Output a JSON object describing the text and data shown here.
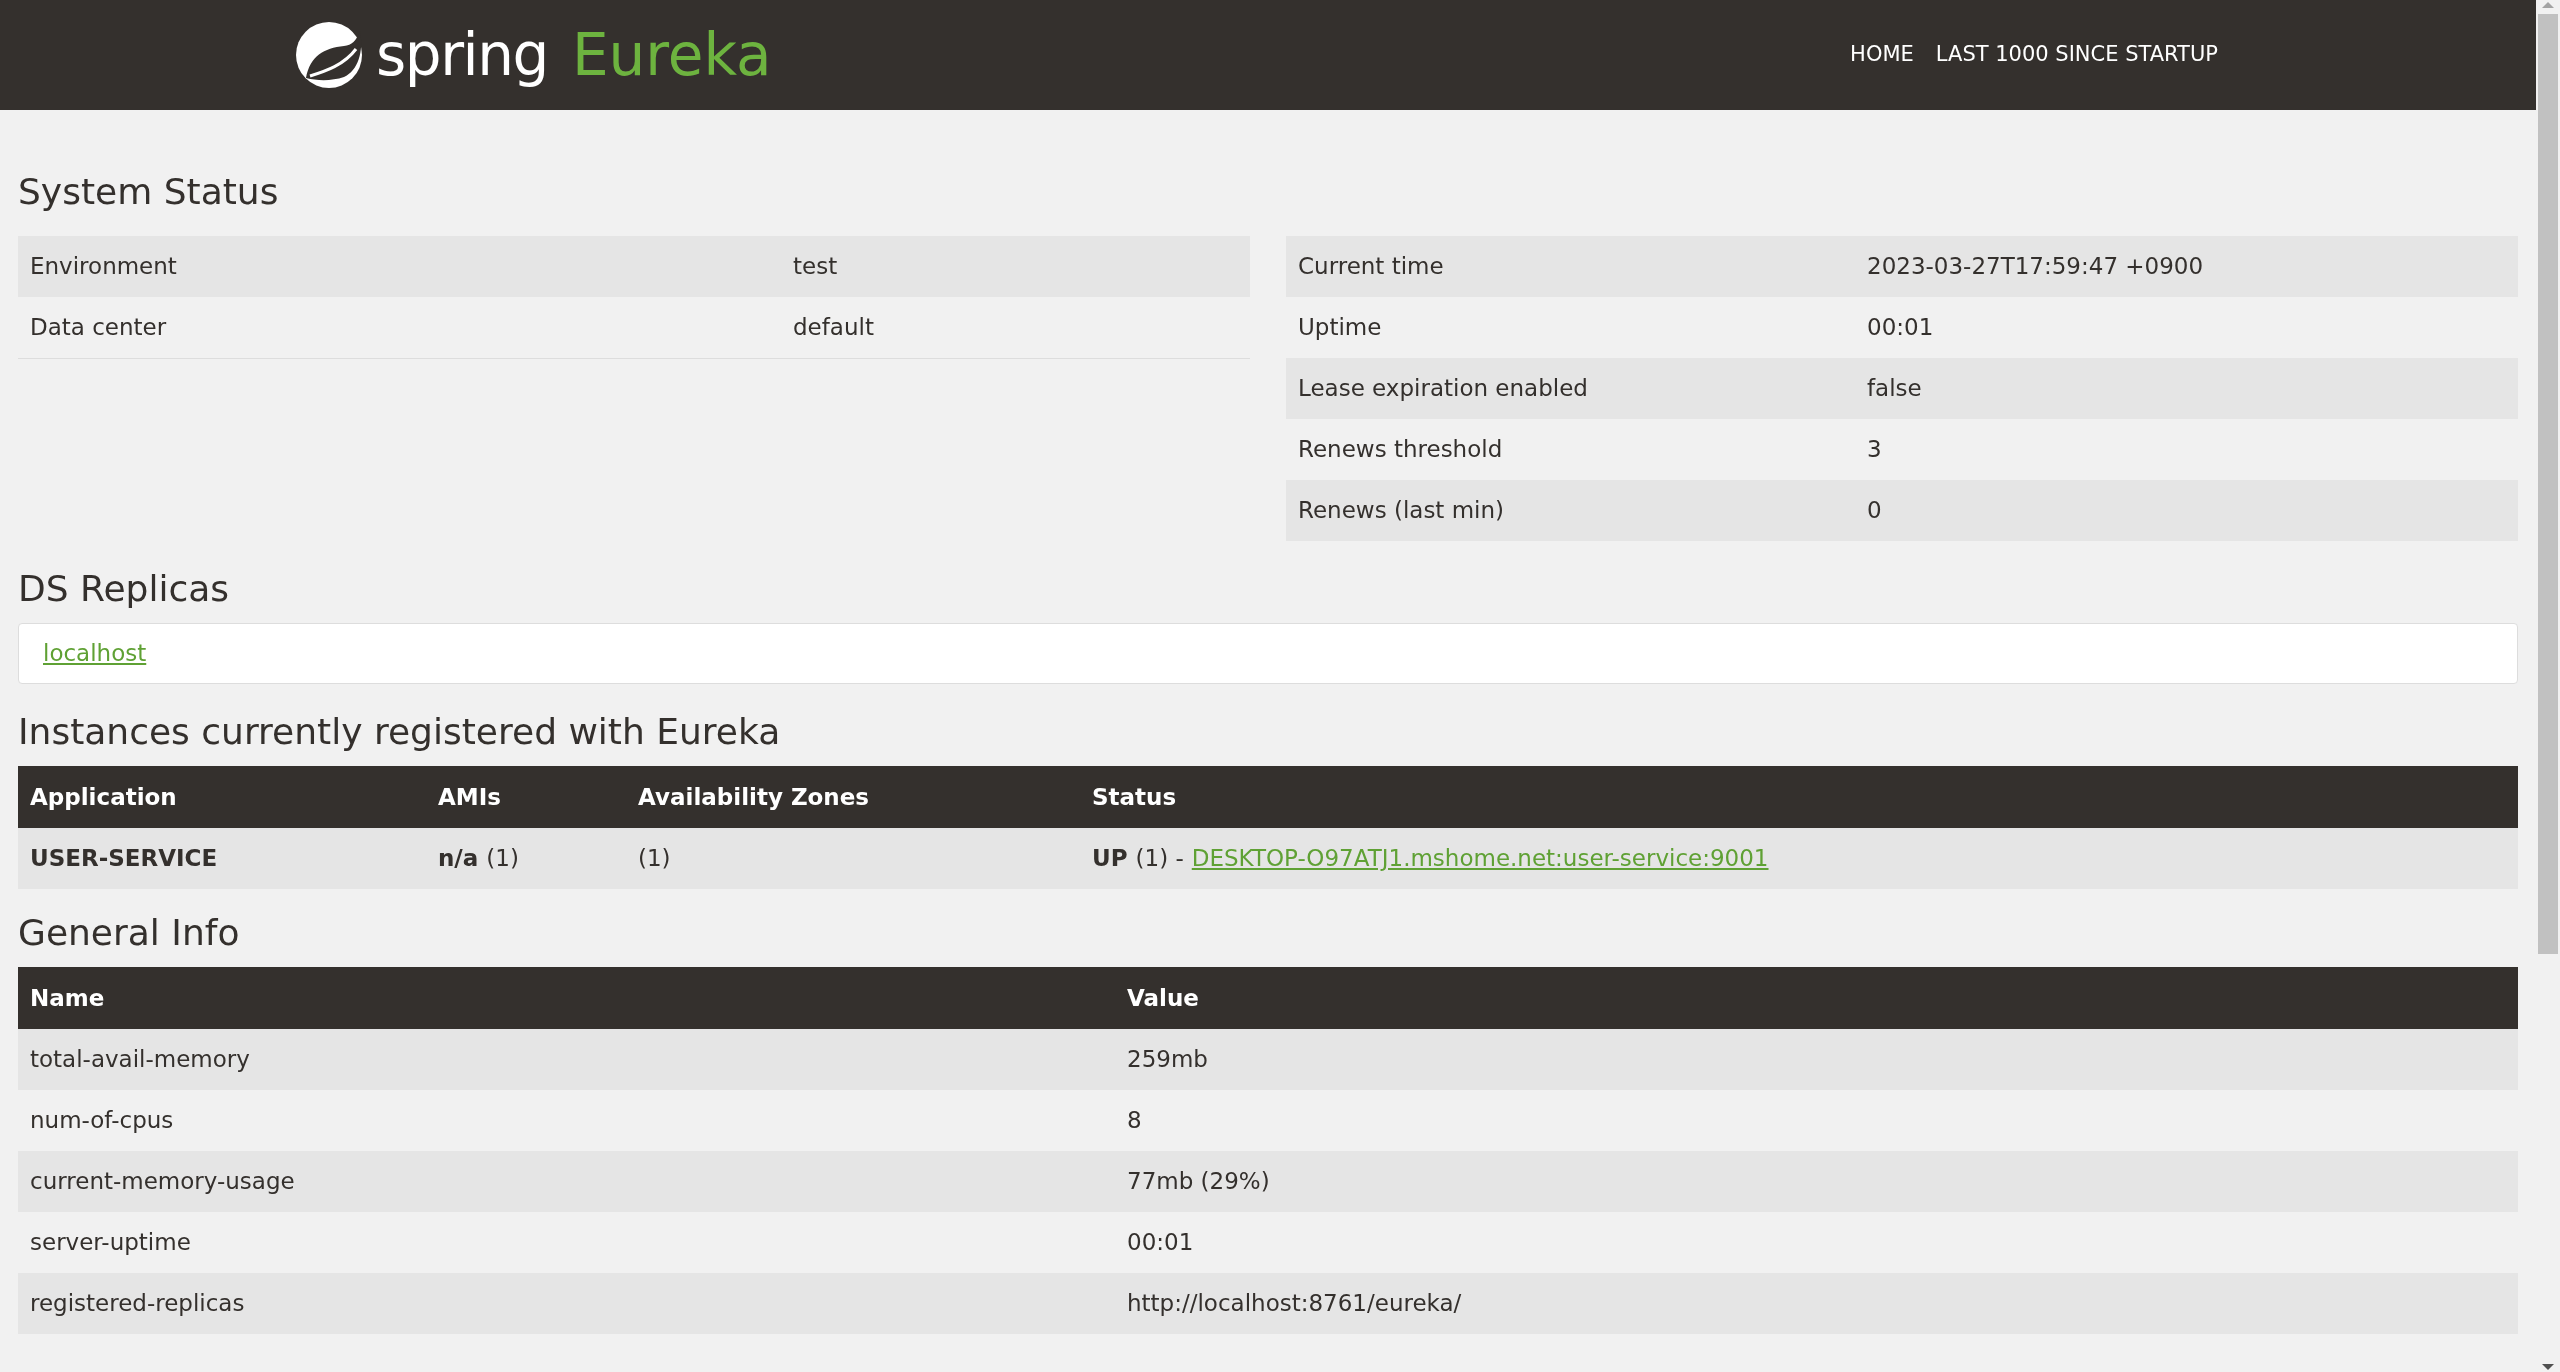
{
  "header": {
    "logo": {
      "word": "spring",
      "product": "Eureka"
    },
    "nav": [
      {
        "label": "HOME"
      },
      {
        "label": "LAST 1000 SINCE STARTUP"
      }
    ]
  },
  "system_status": {
    "title": "System Status",
    "left_rows": [
      {
        "name": "Environment",
        "value": "test"
      },
      {
        "name": "Data center",
        "value": "default"
      }
    ],
    "right_rows": [
      {
        "name": "Current time",
        "value": "2023-03-27T17:59:47 +0900"
      },
      {
        "name": "Uptime",
        "value": "00:01"
      },
      {
        "name": "Lease expiration enabled",
        "value": "false"
      },
      {
        "name": "Renews threshold",
        "value": "3"
      },
      {
        "name": "Renews (last min)",
        "value": "0"
      }
    ]
  },
  "ds_replicas": {
    "title": "DS Replicas",
    "links": [
      "localhost"
    ]
  },
  "instances": {
    "title": "Instances currently registered with Eureka",
    "columns": [
      "Application",
      "AMIs",
      "Availability Zones",
      "Status"
    ],
    "rows": [
      {
        "application": "USER-SERVICE",
        "ami": "n/a",
        "ami_count": "(1)",
        "zones": "(1)",
        "status": "UP",
        "status_count": "(1) -",
        "instance_link": "DESKTOP-O97ATJ1.mshome.net:user-service:9001"
      }
    ]
  },
  "general_info": {
    "title": "General Info",
    "columns": [
      "Name",
      "Value"
    ],
    "rows": [
      {
        "name": "total-avail-memory",
        "value": "259mb"
      },
      {
        "name": "num-of-cpus",
        "value": "8"
      },
      {
        "name": "current-memory-usage",
        "value": "77mb (29%)"
      },
      {
        "name": "server-uptime",
        "value": "00:01"
      },
      {
        "name": "registered-replicas",
        "value": "http://localhost:8761/eureka/"
      }
    ]
  }
}
